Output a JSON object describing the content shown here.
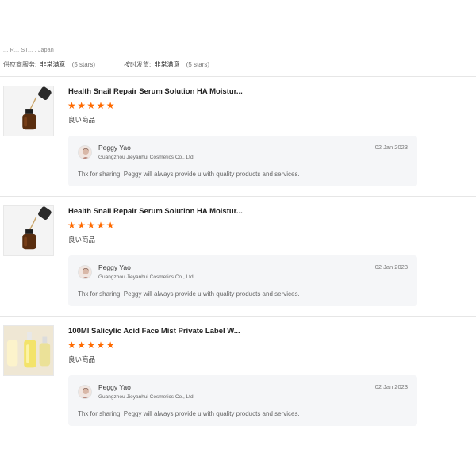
{
  "header": {
    "meta_text": "... R... ST... . Japan",
    "ratings": [
      {
        "label": "供应商服务:",
        "value": "非常满意",
        "sub": "(5 stars)"
      },
      {
        "label": "按时发货:",
        "value": "非常满意",
        "sub": "(5 stars)"
      }
    ]
  },
  "reviews": [
    {
      "product_title": "Health Snail Repair Serum Solution HA Moistur...",
      "rating": 5,
      "comment": "良い商品",
      "reply": {
        "name": "Peggy Yao",
        "company": "Guangzhou Jieyanhui Cosmetics Co., Ltd.",
        "date": "02 Jan 2023",
        "text": "Thx for sharing. Peggy will always provide u with quality products and services."
      }
    },
    {
      "product_title": "Health Snail Repair Serum Solution HA Moistur...",
      "rating": 5,
      "comment": "良い商品",
      "reply": {
        "name": "Peggy Yao",
        "company": "Guangzhou Jieyanhui Cosmetics Co., Ltd.",
        "date": "02 Jan 2023",
        "text": "Thx for sharing. Peggy will always provide u with quality products and services."
      }
    },
    {
      "product_title": "100Ml Salicylic Acid Face Mist Private Label W...",
      "rating": 5,
      "comment": "良い商品",
      "reply": {
        "name": "Peggy Yao",
        "company": "Guangzhou Jieyanhui Cosmetics Co., Ltd.",
        "date": "02 Jan 2023",
        "text": "Thx for sharing. Peggy will always provide u with quality products and services."
      }
    }
  ],
  "colors": {
    "star": "#ff6a00",
    "reply_bg": "#f5f6f8",
    "divider": "#e6e6e6"
  },
  "icons": {
    "star": "star-icon",
    "serum_thumb": "dropper-bottle-image",
    "mist_thumb": "mist-bottles-image"
  }
}
